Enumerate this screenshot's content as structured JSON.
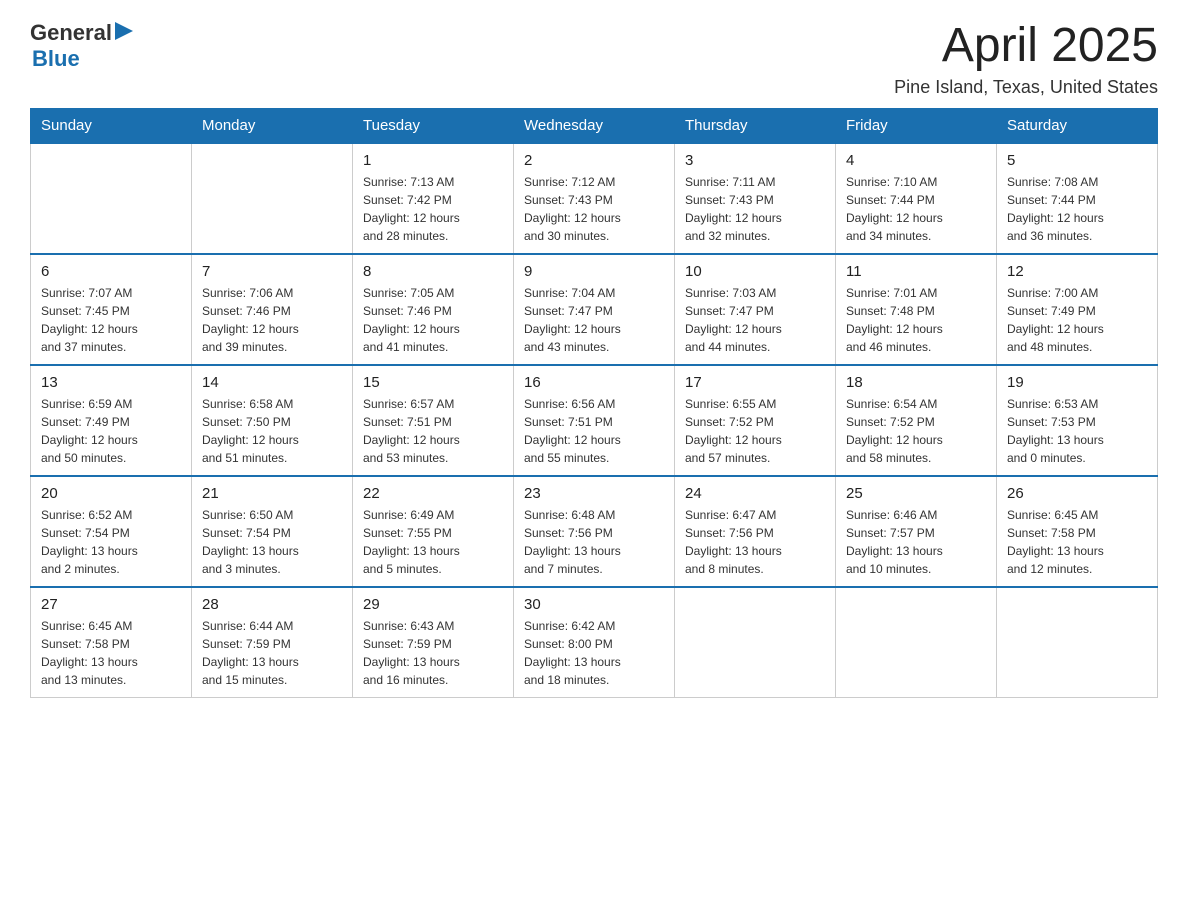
{
  "header": {
    "logo": {
      "general": "General",
      "arrow": "▶",
      "blue": "Blue"
    },
    "title": "April 2025",
    "location": "Pine Island, Texas, United States"
  },
  "calendar": {
    "days_of_week": [
      "Sunday",
      "Monday",
      "Tuesday",
      "Wednesday",
      "Thursday",
      "Friday",
      "Saturday"
    ],
    "weeks": [
      [
        {
          "day": "",
          "info": ""
        },
        {
          "day": "",
          "info": ""
        },
        {
          "day": "1",
          "info": "Sunrise: 7:13 AM\nSunset: 7:42 PM\nDaylight: 12 hours\nand 28 minutes."
        },
        {
          "day": "2",
          "info": "Sunrise: 7:12 AM\nSunset: 7:43 PM\nDaylight: 12 hours\nand 30 minutes."
        },
        {
          "day": "3",
          "info": "Sunrise: 7:11 AM\nSunset: 7:43 PM\nDaylight: 12 hours\nand 32 minutes."
        },
        {
          "day": "4",
          "info": "Sunrise: 7:10 AM\nSunset: 7:44 PM\nDaylight: 12 hours\nand 34 minutes."
        },
        {
          "day": "5",
          "info": "Sunrise: 7:08 AM\nSunset: 7:44 PM\nDaylight: 12 hours\nand 36 minutes."
        }
      ],
      [
        {
          "day": "6",
          "info": "Sunrise: 7:07 AM\nSunset: 7:45 PM\nDaylight: 12 hours\nand 37 minutes."
        },
        {
          "day": "7",
          "info": "Sunrise: 7:06 AM\nSunset: 7:46 PM\nDaylight: 12 hours\nand 39 minutes."
        },
        {
          "day": "8",
          "info": "Sunrise: 7:05 AM\nSunset: 7:46 PM\nDaylight: 12 hours\nand 41 minutes."
        },
        {
          "day": "9",
          "info": "Sunrise: 7:04 AM\nSunset: 7:47 PM\nDaylight: 12 hours\nand 43 minutes."
        },
        {
          "day": "10",
          "info": "Sunrise: 7:03 AM\nSunset: 7:47 PM\nDaylight: 12 hours\nand 44 minutes."
        },
        {
          "day": "11",
          "info": "Sunrise: 7:01 AM\nSunset: 7:48 PM\nDaylight: 12 hours\nand 46 minutes."
        },
        {
          "day": "12",
          "info": "Sunrise: 7:00 AM\nSunset: 7:49 PM\nDaylight: 12 hours\nand 48 minutes."
        }
      ],
      [
        {
          "day": "13",
          "info": "Sunrise: 6:59 AM\nSunset: 7:49 PM\nDaylight: 12 hours\nand 50 minutes."
        },
        {
          "day": "14",
          "info": "Sunrise: 6:58 AM\nSunset: 7:50 PM\nDaylight: 12 hours\nand 51 minutes."
        },
        {
          "day": "15",
          "info": "Sunrise: 6:57 AM\nSunset: 7:51 PM\nDaylight: 12 hours\nand 53 minutes."
        },
        {
          "day": "16",
          "info": "Sunrise: 6:56 AM\nSunset: 7:51 PM\nDaylight: 12 hours\nand 55 minutes."
        },
        {
          "day": "17",
          "info": "Sunrise: 6:55 AM\nSunset: 7:52 PM\nDaylight: 12 hours\nand 57 minutes."
        },
        {
          "day": "18",
          "info": "Sunrise: 6:54 AM\nSunset: 7:52 PM\nDaylight: 12 hours\nand 58 minutes."
        },
        {
          "day": "19",
          "info": "Sunrise: 6:53 AM\nSunset: 7:53 PM\nDaylight: 13 hours\nand 0 minutes."
        }
      ],
      [
        {
          "day": "20",
          "info": "Sunrise: 6:52 AM\nSunset: 7:54 PM\nDaylight: 13 hours\nand 2 minutes."
        },
        {
          "day": "21",
          "info": "Sunrise: 6:50 AM\nSunset: 7:54 PM\nDaylight: 13 hours\nand 3 minutes."
        },
        {
          "day": "22",
          "info": "Sunrise: 6:49 AM\nSunset: 7:55 PM\nDaylight: 13 hours\nand 5 minutes."
        },
        {
          "day": "23",
          "info": "Sunrise: 6:48 AM\nSunset: 7:56 PM\nDaylight: 13 hours\nand 7 minutes."
        },
        {
          "day": "24",
          "info": "Sunrise: 6:47 AM\nSunset: 7:56 PM\nDaylight: 13 hours\nand 8 minutes."
        },
        {
          "day": "25",
          "info": "Sunrise: 6:46 AM\nSunset: 7:57 PM\nDaylight: 13 hours\nand 10 minutes."
        },
        {
          "day": "26",
          "info": "Sunrise: 6:45 AM\nSunset: 7:58 PM\nDaylight: 13 hours\nand 12 minutes."
        }
      ],
      [
        {
          "day": "27",
          "info": "Sunrise: 6:45 AM\nSunset: 7:58 PM\nDaylight: 13 hours\nand 13 minutes."
        },
        {
          "day": "28",
          "info": "Sunrise: 6:44 AM\nSunset: 7:59 PM\nDaylight: 13 hours\nand 15 minutes."
        },
        {
          "day": "29",
          "info": "Sunrise: 6:43 AM\nSunset: 7:59 PM\nDaylight: 13 hours\nand 16 minutes."
        },
        {
          "day": "30",
          "info": "Sunrise: 6:42 AM\nSunset: 8:00 PM\nDaylight: 13 hours\nand 18 minutes."
        },
        {
          "day": "",
          "info": ""
        },
        {
          "day": "",
          "info": ""
        },
        {
          "day": "",
          "info": ""
        }
      ]
    ]
  }
}
